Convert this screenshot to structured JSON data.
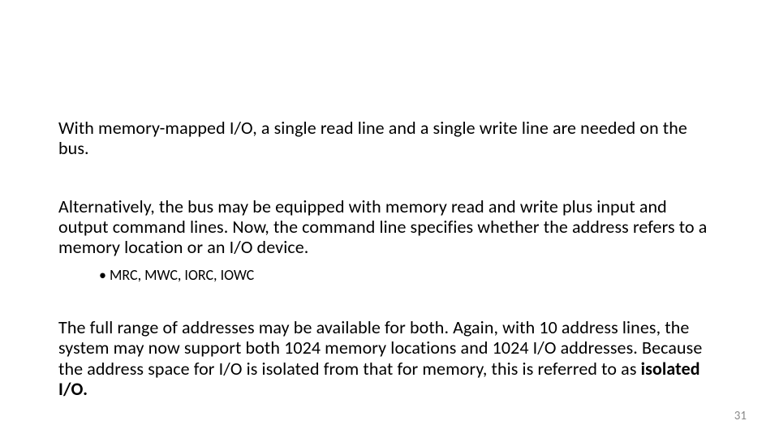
{
  "paragraphs": {
    "p1": "With memory-mapped I/O, a single read line and a single write line are needed on the bus.",
    "p2": "Alternatively, the bus may be equipped with memory read and write plus input and output command lines. Now, the command line specifies whether the address refers to a memory location or an I/O device.",
    "bullet1": "MRC, MWC, IORC, IOWC",
    "p3_a": "The full range of addresses may be available for both. Again, with 10 address lines, the system may now support both 1024 memory locations and 1024 I/O addresses. Because the address space for I/O is isolated from that for memory, this is referred to as ",
    "p3_b": "isolated I/O.",
    "page_number": "31"
  }
}
